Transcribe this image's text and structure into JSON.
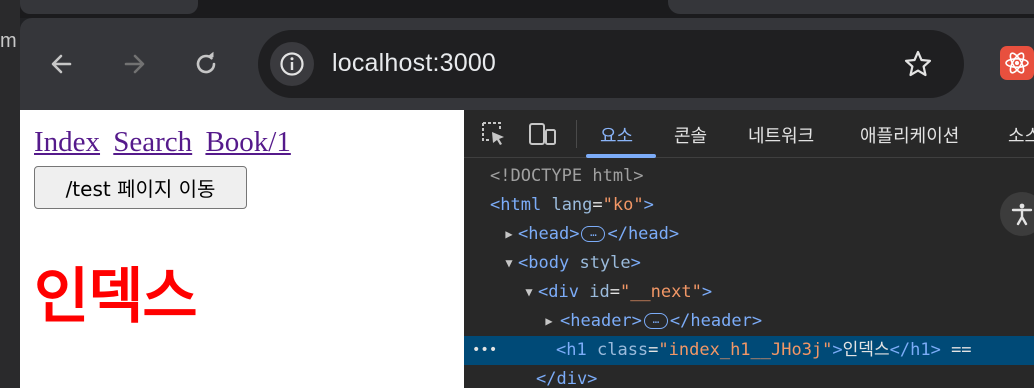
{
  "browser": {
    "url": "localhost:3000",
    "outer_fragment": "m",
    "icons": {
      "back": "arrow-left-icon",
      "forward": "arrow-right-icon",
      "reload": "reload-icon",
      "site_info": "info-icon",
      "bookmark": "star-icon",
      "extension": "react-devtools-icon"
    }
  },
  "page": {
    "links": [
      "Index",
      "Search",
      "Book/1"
    ],
    "button_label": "/test 페이지 이동",
    "heading": "인덱스",
    "colors": {
      "link": "#551a8b",
      "heading": "#ff0000"
    }
  },
  "devtools": {
    "tabs": [
      "요소",
      "콘솔",
      "네트워크",
      "애플리케이션",
      "소스"
    ],
    "active_tab": "요소",
    "dom": {
      "doctype": "<!DOCTYPE html>",
      "html_tag": "html",
      "html_attr": "lang",
      "html_val": "\"ko\"",
      "head_tag": "head",
      "body_tag": "body",
      "body_attr": "style",
      "div_tag": "div",
      "div_attr": "id",
      "div_val": "\"__next\"",
      "header_tag": "header",
      "h1_tag": "h1",
      "h1_attr": "class",
      "h1_val": "\"index_h1__JHo3j\"",
      "h1_text": "인덱스",
      "selected_suffix": "==",
      "div_close": "</div>",
      "ellipsis": "…",
      "row_menu": "•••"
    }
  }
}
